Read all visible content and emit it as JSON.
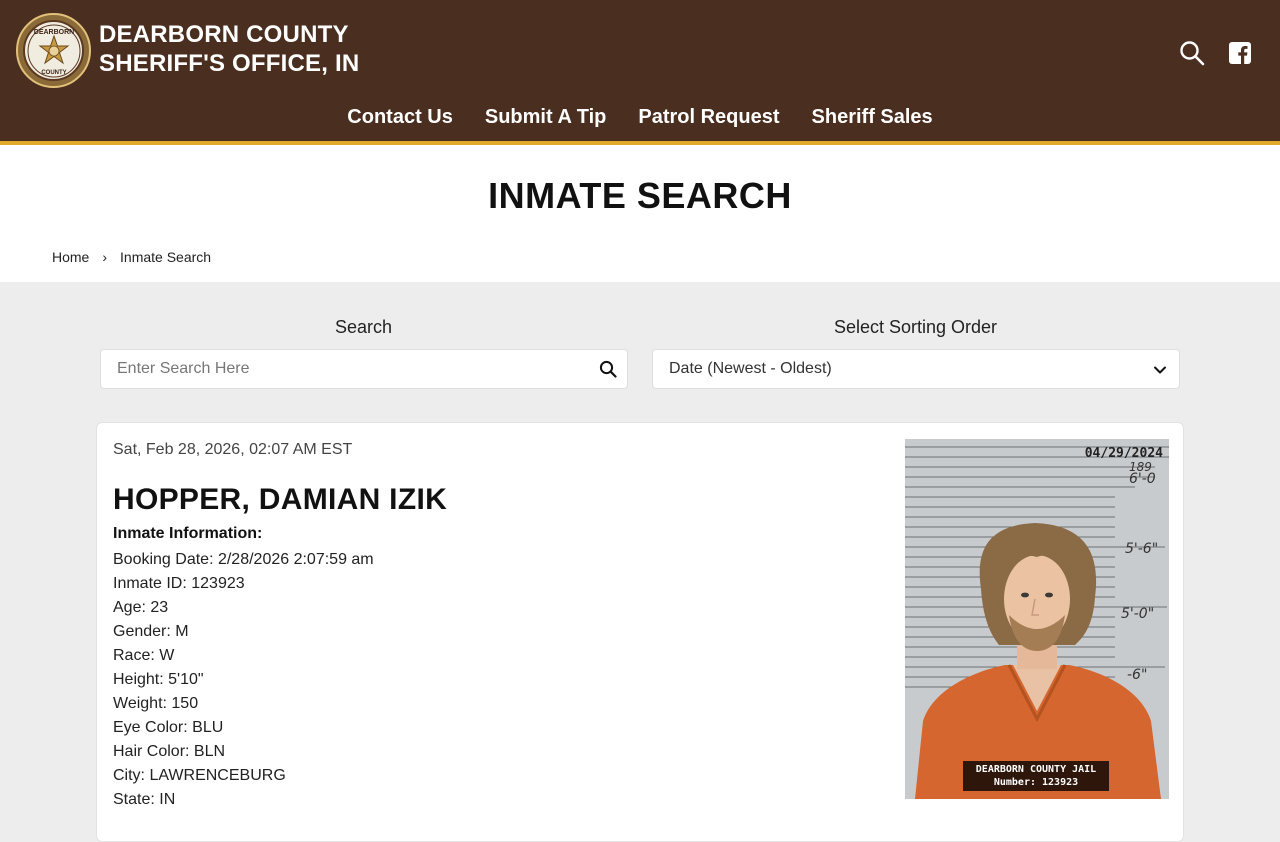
{
  "header": {
    "title_line1": "DEARBORN COUNTY",
    "title_line2": "SHERIFF'S OFFICE, IN",
    "logo": {
      "top_text": "DEARBORN",
      "bottom_text": "COUNTY"
    },
    "icons": [
      "search-icon",
      "facebook-icon"
    ],
    "nav": [
      {
        "label": "Contact Us"
      },
      {
        "label": "Submit A Tip"
      },
      {
        "label": "Patrol Request"
      },
      {
        "label": "Sheriff Sales"
      }
    ],
    "colors": {
      "background": "#4a2e20",
      "accent": "#e0a92a"
    }
  },
  "page": {
    "title": "INMATE SEARCH",
    "breadcrumb": {
      "home": "Home",
      "separator": "›",
      "current": "Inmate Search"
    }
  },
  "search": {
    "label": "Search",
    "placeholder": "Enter Search Here",
    "value": ""
  },
  "sort": {
    "label": "Select Sorting Order",
    "selected": "Date (Newest - Oldest)"
  },
  "inmate": {
    "date": "Sat, Feb 28, 2026, 02:07 AM EST",
    "name": "HOPPER, DAMIAN IZIK",
    "info_heading": "Inmate Information:",
    "fields": [
      "Booking Date: 2/28/2026 2:07:59 am",
      "Inmate ID: 123923",
      "Age: 23",
      "Gender: M",
      "Race: W",
      "Height: 5'10\"",
      "Weight: 150",
      "Eye Color: BLU",
      "Hair Color: BLN",
      "City: LAWRENCEBURG",
      "State: IN"
    ],
    "photo": {
      "stamp_date": "04/29/2024",
      "stamp_line1": "DEARBORN COUNTY JAIL",
      "stamp_line2": "Number: 123923",
      "height_marks": [
        "189",
        "6'-0",
        "5'-6\"",
        "5'-0\"",
        "-6\""
      ]
    }
  }
}
